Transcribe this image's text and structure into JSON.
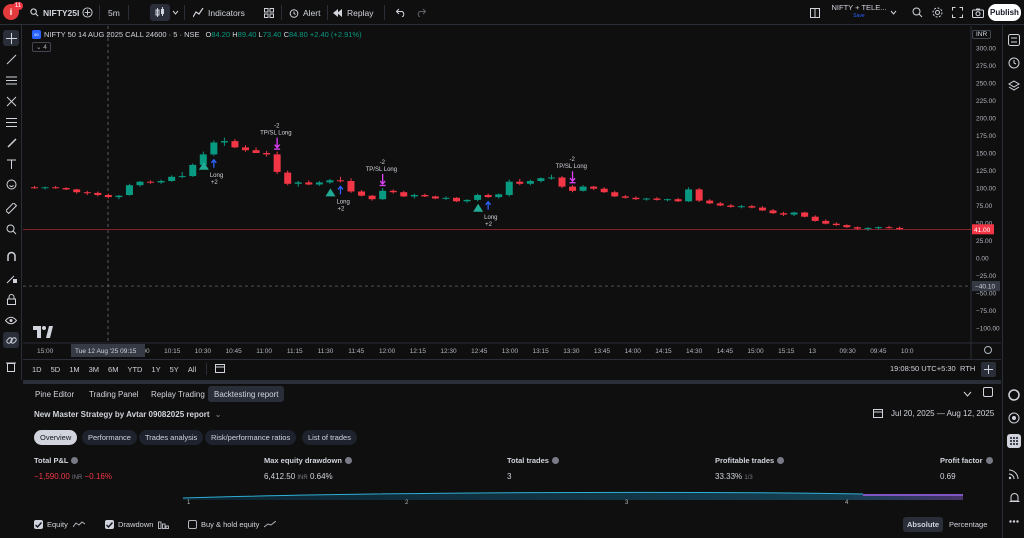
{
  "topbar": {
    "notification_count": "11",
    "symbol": "NIFTY25I",
    "interval": "5m",
    "indicators_label": "Indicators",
    "alert_label": "Alert",
    "replay_label": "Replay",
    "layout_name": "NIFTY + TELE...",
    "layout_sub": "Save",
    "publish_label": "Publish"
  },
  "legend": {
    "symbol_badge": "50",
    "title": "NIFTY 50 14 AUG 2025 CALL 24600 · 5 · NSE",
    "o_label": "O",
    "o_value": "84.20",
    "h_label": "H",
    "h_value": "89.40",
    "l_label": "L",
    "l_value": "73.40",
    "c_label": "C",
    "c_value": "84.80",
    "change": "+2.40 (+2.91%)",
    "indicator_count": "4"
  },
  "chart": {
    "currency": "INR",
    "price_ticks": [
      "300.00",
      "275.00",
      "250.00",
      "225.00",
      "200.00",
      "175.00",
      "150.00",
      "125.00",
      "100.00",
      "75.00",
      "50.00",
      "25.00",
      "0.00",
      "−25.00",
      "−50.00",
      "−75.00",
      "−100.00"
    ],
    "last_price_label": "41.00",
    "crosshair_price_label": "−40.10",
    "time_ticks": [
      "15:00",
      "09:45",
      "10:00",
      "10:15",
      "10:30",
      "10:45",
      "11:00",
      "11:15",
      "11:30",
      "11:45",
      "12:00",
      "12:15",
      "12:30",
      "12:45",
      "13:00",
      "13:15",
      "13:30",
      "13:45",
      "14:00",
      "14:15",
      "14:30",
      "14:45",
      "15:00",
      "15:15",
      "13",
      "09:30",
      "09:45",
      "10:0"
    ],
    "crosshair_time_label": "Tue 12 Aug '25   09:15",
    "colors": {
      "up": "#089981",
      "down": "#f23645",
      "entry": "#2962ff",
      "exit": "#e040fb",
      "long_marker": "#22ab94"
    }
  },
  "chart_data": {
    "type": "candlestick",
    "currency": "INR",
    "y_range": [
      -110,
      310
    ],
    "candles": [
      {
        "o": 101,
        "h": 103,
        "l": 99,
        "c": 100
      },
      {
        "o": 100,
        "h": 102,
        "l": 98,
        "c": 101
      },
      {
        "o": 101,
        "h": 103,
        "l": 99,
        "c": 100
      },
      {
        "o": 100,
        "h": 101,
        "l": 97,
        "c": 98
      },
      {
        "o": 98,
        "h": 99,
        "l": 92,
        "c": 94
      },
      {
        "o": 94,
        "h": 96,
        "l": 90,
        "c": 93
      },
      {
        "o": 93,
        "h": 95,
        "l": 88,
        "c": 90
      },
      {
        "o": 90,
        "h": 92,
        "l": 85,
        "c": 87
      },
      {
        "o": 87,
        "h": 90,
        "l": 84,
        "c": 89
      },
      {
        "o": 90,
        "h": 106,
        "l": 89,
        "c": 104
      },
      {
        "o": 104,
        "h": 110,
        "l": 102,
        "c": 109
      },
      {
        "o": 109,
        "h": 111,
        "l": 106,
        "c": 108
      },
      {
        "o": 108,
        "h": 112,
        "l": 106,
        "c": 110
      },
      {
        "o": 110,
        "h": 118,
        "l": 109,
        "c": 116
      },
      {
        "o": 116,
        "h": 123,
        "l": 114,
        "c": 117
      },
      {
        "o": 117,
        "h": 135,
        "l": 116,
        "c": 133
      },
      {
        "o": 133,
        "h": 152,
        "l": 130,
        "c": 148
      },
      {
        "o": 148,
        "h": 168,
        "l": 146,
        "c": 165
      },
      {
        "o": 165,
        "h": 172,
        "l": 160,
        "c": 167
      },
      {
        "o": 167,
        "h": 170,
        "l": 157,
        "c": 158
      },
      {
        "o": 158,
        "h": 161,
        "l": 152,
        "c": 154
      },
      {
        "o": 154,
        "h": 158,
        "l": 150,
        "c": 150
      },
      {
        "o": 150,
        "h": 153,
        "l": 145,
        "c": 148
      },
      {
        "o": 148,
        "h": 152,
        "l": 120,
        "c": 123
      },
      {
        "o": 122,
        "h": 125,
        "l": 104,
        "c": 106
      },
      {
        "o": 106,
        "h": 110,
        "l": 102,
        "c": 108
      },
      {
        "o": 108,
        "h": 111,
        "l": 104,
        "c": 105
      },
      {
        "o": 105,
        "h": 110,
        "l": 103,
        "c": 108
      },
      {
        "o": 108,
        "h": 113,
        "l": 106,
        "c": 111
      },
      {
        "o": 111,
        "h": 116,
        "l": 108,
        "c": 110
      },
      {
        "o": 110,
        "h": 114,
        "l": 93,
        "c": 95
      },
      {
        "o": 95,
        "h": 97,
        "l": 88,
        "c": 89
      },
      {
        "o": 89,
        "h": 90,
        "l": 82,
        "c": 84
      },
      {
        "o": 84,
        "h": 100,
        "l": 83,
        "c": 96
      },
      {
        "o": 96,
        "h": 98,
        "l": 92,
        "c": 94
      },
      {
        "o": 94,
        "h": 96,
        "l": 87,
        "c": 88
      },
      {
        "o": 88,
        "h": 92,
        "l": 85,
        "c": 90
      },
      {
        "o": 90,
        "h": 92,
        "l": 87,
        "c": 88
      },
      {
        "o": 88,
        "h": 89,
        "l": 84,
        "c": 85
      },
      {
        "o": 85,
        "h": 88,
        "l": 83,
        "c": 86
      },
      {
        "o": 86,
        "h": 87,
        "l": 80,
        "c": 81
      },
      {
        "o": 81,
        "h": 84,
        "l": 79,
        "c": 83
      },
      {
        "o": 83,
        "h": 92,
        "l": 81,
        "c": 90
      },
      {
        "o": 90,
        "h": 92,
        "l": 86,
        "c": 87
      },
      {
        "o": 87,
        "h": 92,
        "l": 85,
        "c": 91
      },
      {
        "o": 90,
        "h": 112,
        "l": 88,
        "c": 109
      },
      {
        "o": 109,
        "h": 113,
        "l": 104,
        "c": 106
      },
      {
        "o": 106,
        "h": 112,
        "l": 104,
        "c": 110
      },
      {
        "o": 110,
        "h": 115,
        "l": 108,
        "c": 114
      },
      {
        "o": 114,
        "h": 119,
        "l": 112,
        "c": 115
      },
      {
        "o": 115,
        "h": 117,
        "l": 100,
        "c": 102
      },
      {
        "o": 102,
        "h": 104,
        "l": 94,
        "c": 96
      },
      {
        "o": 96,
        "h": 104,
        "l": 95,
        "c": 102
      },
      {
        "o": 102,
        "h": 103,
        "l": 97,
        "c": 99
      },
      {
        "o": 99,
        "h": 101,
        "l": 93,
        "c": 94
      },
      {
        "o": 94,
        "h": 96,
        "l": 87,
        "c": 88
      },
      {
        "o": 88,
        "h": 90,
        "l": 85,
        "c": 86
      },
      {
        "o": 86,
        "h": 88,
        "l": 83,
        "c": 84
      },
      {
        "o": 84,
        "h": 86,
        "l": 82,
        "c": 85
      },
      {
        "o": 85,
        "h": 87,
        "l": 82,
        "c": 83
      },
      {
        "o": 83,
        "h": 85,
        "l": 81,
        "c": 84
      },
      {
        "o": 84,
        "h": 86,
        "l": 80,
        "c": 81
      },
      {
        "o": 81,
        "h": 101,
        "l": 80,
        "c": 98
      },
      {
        "o": 98,
        "h": 100,
        "l": 80,
        "c": 82
      },
      {
        "o": 82,
        "h": 84,
        "l": 77,
        "c": 78
      },
      {
        "o": 78,
        "h": 80,
        "l": 74,
        "c": 75
      },
      {
        "o": 75,
        "h": 77,
        "l": 72,
        "c": 73
      },
      {
        "o": 73,
        "h": 76,
        "l": 71,
        "c": 74
      },
      {
        "o": 74,
        "h": 76,
        "l": 71,
        "c": 72
      },
      {
        "o": 72,
        "h": 74,
        "l": 67,
        "c": 68
      },
      {
        "o": 68,
        "h": 70,
        "l": 63,
        "c": 64
      },
      {
        "o": 64,
        "h": 66,
        "l": 60,
        "c": 62
      },
      {
        "o": 62,
        "h": 66,
        "l": 60,
        "c": 65
      },
      {
        "o": 65,
        "h": 66,
        "l": 58,
        "c": 59
      },
      {
        "o": 59,
        "h": 61,
        "l": 52,
        "c": 53
      },
      {
        "o": 53,
        "h": 55,
        "l": 48,
        "c": 49
      },
      {
        "o": 49,
        "h": 51,
        "l": 46,
        "c": 47
      },
      {
        "o": 47,
        "h": 48,
        "l": 43,
        "c": 44
      },
      {
        "o": 44,
        "h": 45,
        "l": 40,
        "c": 42
      },
      {
        "o": 42,
        "h": 44,
        "l": 39,
        "c": 43
      },
      {
        "o": 43,
        "h": 45,
        "l": 41,
        "c": 44
      },
      {
        "o": 44,
        "h": 46,
        "l": 42,
        "c": 43
      },
      {
        "o": 43,
        "h": 45,
        "l": 40,
        "c": 41
      }
    ],
    "signals": [
      {
        "type": "long_entry",
        "bar": 17,
        "label": "Long",
        "qty": "+2"
      },
      {
        "type": "exit",
        "bar": 23,
        "label": "TP/SL Long",
        "qty": "-2"
      },
      {
        "type": "long_entry",
        "bar": 29,
        "label": "Long",
        "qty": "+2"
      },
      {
        "type": "exit",
        "bar": 33,
        "label": "TP/SL Long",
        "qty": "-2"
      },
      {
        "type": "long_entry",
        "bar": 43,
        "label": "Long",
        "qty": "+2"
      },
      {
        "type": "exit",
        "bar": 51,
        "label": "TP/SL Long",
        "qty": "-2"
      }
    ],
    "equity_curve": [
      0,
      1,
      2,
      3,
      4
    ]
  },
  "timeframes": [
    "1D",
    "5D",
    "1M",
    "3M",
    "6M",
    "YTD",
    "1Y",
    "5Y",
    "All"
  ],
  "status": {
    "clock": "19:08:50 UTC+5:30",
    "session": "RTH"
  },
  "panel_tabs": [
    "Pine Editor",
    "Trading Panel",
    "Replay Trading",
    "Backtesting report"
  ],
  "report": {
    "title": "New Master Strategy by Avtar 09082025 report",
    "date_range": "Jul 20, 2025 — Aug 12, 2025",
    "tabs": [
      "Overview",
      "Performance",
      "Trades analysis",
      "Risk/performance ratios",
      "List of trades"
    ],
    "metrics": {
      "pnl_label": "Total P&L",
      "pnl_value": "−1,590.00",
      "pnl_unit": "INR",
      "pnl_pct": "−0.16%",
      "dd_label": "Max equity drawdown",
      "dd_value": "6,412.50",
      "dd_unit": "INR",
      "dd_pct": "0.64%",
      "trades_label": "Total trades",
      "trades_value": "3",
      "profit_label": "Profitable trades",
      "profit_value": "33.33%",
      "profit_sub": "1/3",
      "pf_label": "Profit factor",
      "pf_value": "0.69"
    },
    "x_ticks": [
      "1",
      "2",
      "3",
      "4"
    ],
    "checks": [
      {
        "label": "Equity",
        "checked": true
      },
      {
        "label": "Drawdown",
        "checked": true
      },
      {
        "label": "Buy & hold equity",
        "checked": false
      }
    ],
    "absolute_label": "Absolute",
    "percentage_label": "Percentage"
  }
}
